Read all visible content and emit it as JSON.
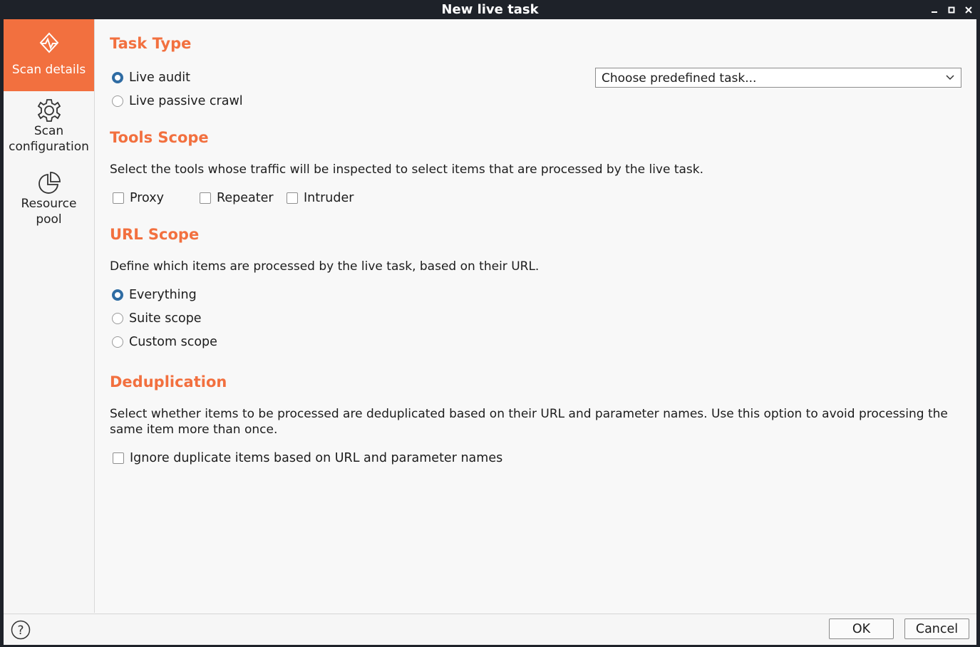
{
  "window": {
    "title": "New live task"
  },
  "sidebar": {
    "items": [
      {
        "label": "Scan details",
        "icon": "scan-details-icon",
        "active": true
      },
      {
        "label": "Scan configuration",
        "label_lines": [
          "Scan",
          "configuration"
        ],
        "icon": "gear-icon",
        "active": false
      },
      {
        "label": "Resource pool",
        "label_lines": [
          "Resource",
          "pool"
        ],
        "icon": "pie-chart-icon",
        "active": false
      }
    ]
  },
  "task_type": {
    "title": "Task Type",
    "options": [
      {
        "label": "Live audit",
        "selected": true
      },
      {
        "label": "Live passive crawl",
        "selected": false
      }
    ],
    "predefined_task": {
      "value": "Choose predefined task..."
    }
  },
  "tools_scope": {
    "title": "Tools Scope",
    "description": "Select the tools whose traffic will be inspected to select items that are processed by the live task.",
    "tools": [
      {
        "label": "Proxy",
        "checked": false
      },
      {
        "label": "Repeater",
        "checked": false
      },
      {
        "label": "Intruder",
        "checked": false
      }
    ]
  },
  "url_scope": {
    "title": "URL Scope",
    "description": "Define which items are processed by the live task, based on their URL.",
    "options": [
      {
        "label": "Everything",
        "selected": true
      },
      {
        "label": "Suite scope",
        "selected": false
      },
      {
        "label": "Custom scope",
        "selected": false
      }
    ]
  },
  "deduplication": {
    "title": "Deduplication",
    "description": "Select whether items to be processed are deduplicated based on their URL and parameter names. Use this option to avoid processing the same item more than once.",
    "option": {
      "label": "Ignore duplicate items based on URL and parameter names",
      "checked": false
    }
  },
  "footer": {
    "ok_label": "OK",
    "cancel_label": "Cancel",
    "help_icon": "help-icon"
  },
  "colors": {
    "accent": "#f2703f",
    "radio_selected": "#2f6ca3",
    "titlebar": "#1e2229"
  }
}
